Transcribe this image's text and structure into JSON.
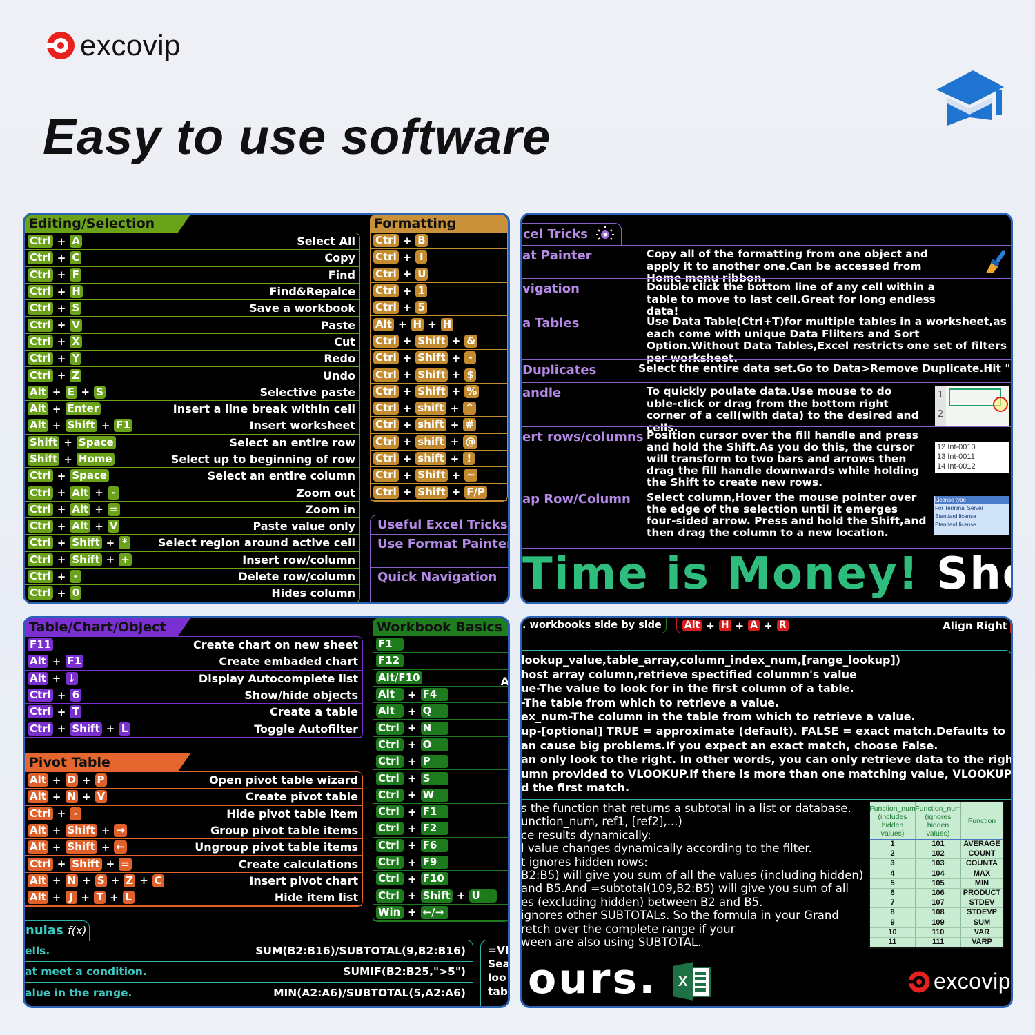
{
  "brand": {
    "name": "excovip",
    "accent": "#e8211e"
  },
  "hero": {
    "title": "Easy to use software",
    "icon": "graduation-cap-icon"
  },
  "editing": {
    "title": "Editing/Selection",
    "color": "#6aa219",
    "rows": [
      {
        "keys": [
          "Ctrl",
          "A"
        ],
        "desc": "Select All"
      },
      {
        "keys": [
          "Ctrl",
          "C"
        ],
        "desc": "Copy"
      },
      {
        "keys": [
          "Ctrl",
          "F"
        ],
        "desc": "Find"
      },
      {
        "keys": [
          "Ctrl",
          "H"
        ],
        "desc": "Find&Repalce"
      },
      {
        "keys": [
          "Ctrl",
          "S"
        ],
        "desc": "Save a workbook"
      },
      {
        "keys": [
          "Ctrl",
          "V"
        ],
        "desc": "Paste"
      },
      {
        "keys": [
          "Ctrl",
          "X"
        ],
        "desc": "Cut"
      },
      {
        "keys": [
          "Ctrl",
          "Y"
        ],
        "desc": "Redo"
      },
      {
        "keys": [
          "Ctrl",
          "Z"
        ],
        "desc": "Undo"
      },
      {
        "keys": [
          "Alt",
          "E",
          "S"
        ],
        "desc": "Selective paste"
      },
      {
        "keys": [
          "Alt",
          "Enter"
        ],
        "desc": "Insert a line break within cell"
      },
      {
        "keys": [
          "Alt",
          "Shift",
          "F1"
        ],
        "desc": "Insert worksheet"
      },
      {
        "keys": [
          "Shift",
          "Space"
        ],
        "desc": "Select an entire row"
      },
      {
        "keys": [
          "Shift",
          "Home"
        ],
        "desc": "Select up to beginning of row"
      },
      {
        "keys": [
          "Ctrl",
          "Space"
        ],
        "desc": "Select an entire column"
      },
      {
        "keys": [
          "Ctrl",
          "Alt",
          "-"
        ],
        "desc": "Zoom out"
      },
      {
        "keys": [
          "Ctrl",
          "Alt",
          "="
        ],
        "desc": "Zoom in"
      },
      {
        "keys": [
          "Ctrl",
          "Alt",
          "V"
        ],
        "desc": "Paste value only"
      },
      {
        "keys": [
          "Ctrl",
          "Shift",
          "*"
        ],
        "desc": "Select region around active cell"
      },
      {
        "keys": [
          "Ctrl",
          "Shift",
          "+"
        ],
        "desc": "Insert row/column"
      },
      {
        "keys": [
          "Ctrl",
          "-"
        ],
        "desc": "Delete row/column"
      },
      {
        "keys": [
          "Ctrl",
          "0"
        ],
        "desc": "Hides column"
      }
    ]
  },
  "formatting": {
    "title": "Formatting",
    "color": "#c38b2e",
    "rows": [
      {
        "keys": [
          "Ctrl",
          "B"
        ]
      },
      {
        "keys": [
          "Ctrl",
          "I"
        ]
      },
      {
        "keys": [
          "Ctrl",
          "U"
        ]
      },
      {
        "keys": [
          "Ctrl",
          "1"
        ]
      },
      {
        "keys": [
          "Ctrl",
          "5"
        ]
      },
      {
        "keys": [
          "Alt",
          "H",
          "H"
        ]
      },
      {
        "keys": [
          "Ctrl",
          "Shift",
          "&"
        ]
      },
      {
        "keys": [
          "Ctrl",
          "Shift",
          "-"
        ]
      },
      {
        "keys": [
          "Ctrl",
          "Shift",
          "$"
        ]
      },
      {
        "keys": [
          "Ctrl",
          "Shift",
          "%"
        ]
      },
      {
        "keys": [
          "Ctrl",
          "shift",
          "^"
        ]
      },
      {
        "keys": [
          "Ctrl",
          "shift",
          "#"
        ]
      },
      {
        "keys": [
          "Ctrl",
          "shift",
          "@"
        ]
      },
      {
        "keys": [
          "Ctrl",
          "shift",
          "!"
        ]
      },
      {
        "keys": [
          "Ctrl",
          "Shift",
          "~"
        ]
      },
      {
        "keys": [
          "Ctrl",
          "Shift",
          "F/P"
        ]
      }
    ]
  },
  "tricks_mini": {
    "items": [
      "Useful Excel Tricks",
      "Use Format Painter",
      "Quick Navigation"
    ]
  },
  "tricks": {
    "tab": "cel Tricks",
    "rows": [
      {
        "name": "at Painter",
        "desc": "Copy all of the formatting from one object and apply it to another one.Can be accessed from Home menu ribbon.",
        "icon": "paint-brush-icon"
      },
      {
        "name": "vigation",
        "desc": "Double click the bottom line of any cell within a table to move to last cell.Great for long endless data!"
      },
      {
        "name": "a Tables",
        "desc": "Use Data Table(Ctrl+T)for multiple tables in a worksheet,as each come with unique Data Flilters and Sort Option.Without Data Tables,Excel restricts one set of filters per worksheet."
      },
      {
        "name": "Duplicates",
        "desc": "Select the entire data set.Go to Data>Remove Duplicate.Hit \"OK\"."
      },
      {
        "name": "andle",
        "desc": "To quickly poulate data.Use mouse to do uble-click or drag from the bottom right corner of a cell(with data) to the desired and cells."
      },
      {
        "name": "ert rows/columns",
        "desc": "Position cursor over the fill handle and press and hold the Shift.As you do this, the cursor will transform to two bars and arrows then drag the fill handle downwards while holding the Shift to create new rows."
      },
      {
        "name": "ap Row/Column",
        "desc": "Select column,Hover the mouse pointer over the edge of the selection until it  emerges four-sided arrow. Press and hold the Shift,and then drag the column to a new location."
      }
    ],
    "fill_img": {
      "rows": [
        "1",
        "2"
      ]
    },
    "insert_img": {
      "rows": [
        "12 Int-0010",
        "13 Int-0011",
        "14 Int-0012"
      ]
    },
    "swap_img": {
      "rows": [
        "License type",
        "For Terminal Server",
        "Standard license",
        "Standard license"
      ]
    }
  },
  "slogan": {
    "green": "Time is Money!",
    "white": "Sho",
    "tail": "ours."
  },
  "table_chart": {
    "title": "Table/Chart/Object",
    "color": "#7a2fd0",
    "rows": [
      {
        "keys": [
          "F11"
        ],
        "desc": "Create chart on new sheet"
      },
      {
        "keys": [
          "Alt",
          "F1"
        ],
        "desc": "Create embaded chart"
      },
      {
        "keys": [
          "Alt",
          "↓"
        ],
        "desc": "Display Autocomplete list"
      },
      {
        "keys": [
          "Ctrl",
          "6"
        ],
        "desc": "Show/hide objects"
      },
      {
        "keys": [
          "Ctrl",
          "T"
        ],
        "desc": "Create a table"
      },
      {
        "keys": [
          "Ctrl",
          "Shift",
          "L"
        ],
        "desc": "Toggle Autofilter"
      }
    ]
  },
  "pivot": {
    "title": "Pivot Table",
    "color": "#e0602a",
    "rows": [
      {
        "keys": [
          "Alt",
          "D",
          "P"
        ],
        "desc": "Open pivot table wizard"
      },
      {
        "keys": [
          "Alt",
          "N",
          "V"
        ],
        "desc": "Create pivot table"
      },
      {
        "keys": [
          "Ctrl",
          "-"
        ],
        "desc": "Hide pivot table item"
      },
      {
        "keys": [
          "Alt",
          "Shift",
          "→"
        ],
        "desc": "Group pivot table items"
      },
      {
        "keys": [
          "Alt",
          "Shift",
          "←"
        ],
        "desc": "Ungroup pivot table items"
      },
      {
        "keys": [
          "Ctrl",
          "Shift",
          "="
        ],
        "desc": "Create calculations"
      },
      {
        "keys": [
          "Alt",
          "N",
          "S",
          "Z",
          "C"
        ],
        "desc": "Insert pivot chart"
      },
      {
        "keys": [
          "Alt",
          "J",
          "T",
          "L"
        ],
        "desc": "Hide item list"
      }
    ]
  },
  "workbook": {
    "title": "Workbook Basics",
    "color": "#1d7a1d",
    "stray": "A",
    "rows": [
      {
        "keys": [
          "F1"
        ]
      },
      {
        "keys": [
          "F12"
        ]
      },
      {
        "keys": [
          "Alt/F10"
        ]
      },
      {
        "keys": [
          "Alt",
          "F4"
        ]
      },
      {
        "keys": [
          "Alt",
          "Q"
        ]
      },
      {
        "keys": [
          "Ctrl",
          "N"
        ]
      },
      {
        "keys": [
          "Ctrl",
          "O"
        ]
      },
      {
        "keys": [
          "Ctrl",
          "P"
        ]
      },
      {
        "keys": [
          "Ctrl",
          "S"
        ]
      },
      {
        "keys": [
          "Ctrl",
          "W"
        ]
      },
      {
        "keys": [
          "Ctrl",
          "F1"
        ]
      },
      {
        "keys": [
          "Ctrl",
          "F2"
        ]
      },
      {
        "keys": [
          "Ctrl",
          "F6"
        ]
      },
      {
        "keys": [
          "Ctrl",
          "F9"
        ]
      },
      {
        "keys": [
          "Ctrl",
          "F10"
        ]
      },
      {
        "keys": [
          "Ctrl",
          "Shift",
          "U"
        ]
      },
      {
        "keys": [
          "Win",
          "←/→"
        ]
      }
    ]
  },
  "formulas": {
    "tab": "nulas",
    "tab_icon": "f(x)",
    "rows": [
      {
        "desc": "ells.",
        "code": "SUM(B2:B16)/SUBTOTAL(9,B2:B16)"
      },
      {
        "desc": "at meet a condition.",
        "code": "SUMIF(B2:B25,\">5\")"
      },
      {
        "desc": "alue in the range.",
        "code": "MIN(A2:A6)/SUBTOTAL(5,A2:A6)"
      }
    ],
    "vl_fragment": [
      "=VI",
      "Sea",
      "loo",
      "tab"
    ]
  },
  "bottom_right": {
    "side_label": ". workbooks side by side",
    "align_keys": [
      "Alt",
      "H",
      "A",
      "R"
    ],
    "align_desc": "Align Right",
    "vlookup_lines": [
      "lookup_value,table_array,column_index_num,[range_lookup])",
      "host array column,retrieve spectified colunmn's value",
      "ue-The value to look for in the first column of a table.",
      "-The table from which to retrieve a value.",
      "ex_num-The column in the table from which to retrieve a value.",
      "up-[optional] TRUE = approximate (default). FALSE = exact match.Defaults to",
      "an cause big problems.If you expect an exact match, choose False.",
      "an only look to the right. In other words, you can only retrieve data to the right of",
      "umn provided to VLOOKUP.If there is more than one matching value, VLOOKUP",
      "d the first match."
    ],
    "subtotal_lines": [
      "s the function that returns a subtotal in a list or database.",
      "unction_num, ref1, [ref2],...)",
      "ce results dynamically:",
      "l value changes dynamically according to the filter.",
      "t ignores hidden rows:",
      "B2:B5) will give you sum of all the values (including hidden)",
      " and B5.And =subtotal(109,B2:B5) will give you sum of all",
      "es (excluding hidden) between B2 and B5.",
      "ignores other SUBTOTALs. So the formula in your Grand",
      "retch over the complete range if your",
      "ween are also using SUBTOTAL."
    ],
    "fn_table": {
      "headers": [
        "Function_num (includes hidden values)",
        "Function_num (ignores hidden values)",
        "Function"
      ],
      "rows": [
        [
          "1",
          "101",
          "AVERAGE"
        ],
        [
          "2",
          "102",
          "COUNT"
        ],
        [
          "3",
          "103",
          "COUNTA"
        ],
        [
          "4",
          "104",
          "MAX"
        ],
        [
          "5",
          "105",
          "MIN"
        ],
        [
          "6",
          "106",
          "PRODUCT"
        ],
        [
          "7",
          "107",
          "STDEV"
        ],
        [
          "8",
          "108",
          "STDEVP"
        ],
        [
          "9",
          "109",
          "SUM"
        ],
        [
          "10",
          "110",
          "VAR"
        ],
        [
          "11",
          "111",
          "VARP"
        ]
      ]
    }
  }
}
